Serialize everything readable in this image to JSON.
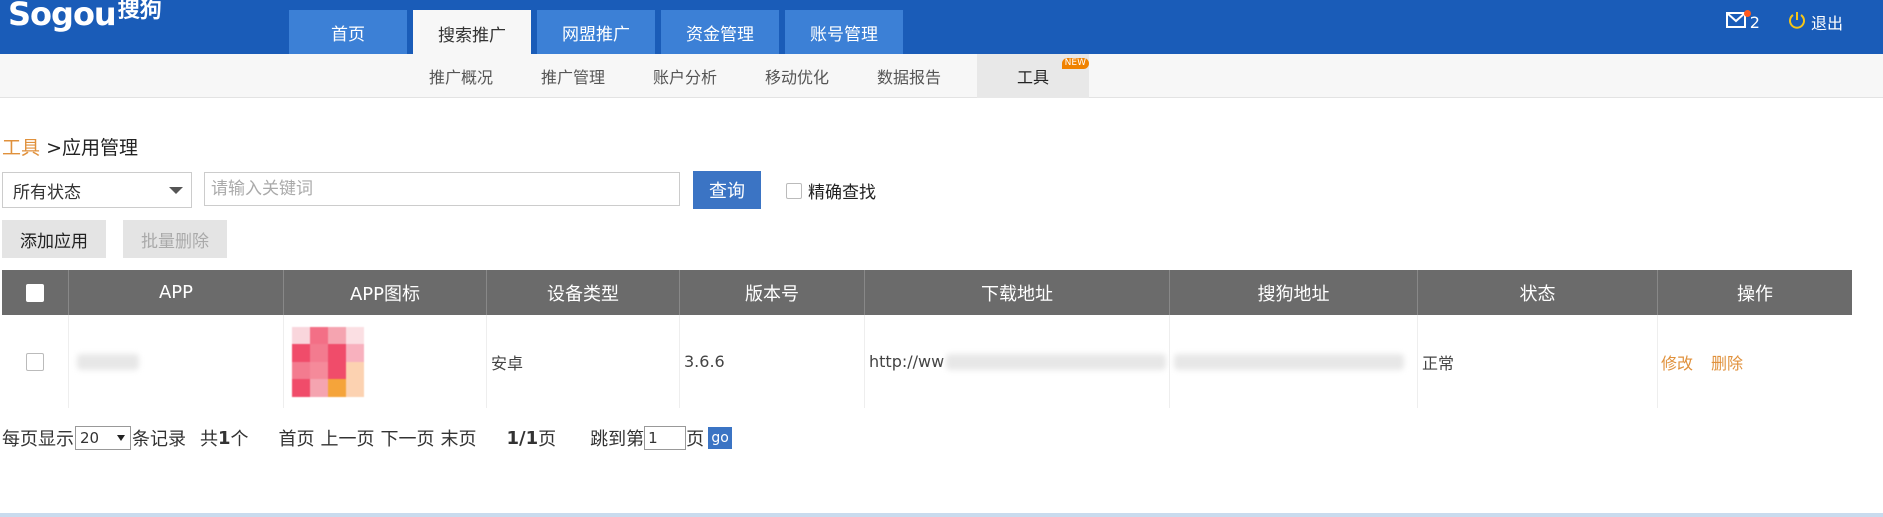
{
  "header": {
    "logo_text": "Sogou",
    "logo_cn": "搜狗",
    "tabs": [
      {
        "label": "首页"
      },
      {
        "label": "搜索推广"
      },
      {
        "label": "网盟推广"
      },
      {
        "label": "资金管理"
      },
      {
        "label": "账号管理"
      }
    ],
    "active_tab": "搜索推广",
    "mail_count": "2",
    "logout_label": "退出"
  },
  "subnav": {
    "items": [
      {
        "label": "推广概况"
      },
      {
        "label": "推广管理"
      },
      {
        "label": "账户分析"
      },
      {
        "label": "移动优化"
      },
      {
        "label": "数据报告"
      },
      {
        "label": "工具"
      }
    ],
    "active": "工具",
    "new_badge": "NEW"
  },
  "breadcrumb": {
    "link": "工具",
    "separator": ">",
    "current": "应用管理"
  },
  "filter": {
    "status_selected": "所有状态",
    "keyword_placeholder": "请输入关键词",
    "query_label": "查询",
    "exact_label": "精确查找"
  },
  "actions": {
    "add_label": "添加应用",
    "batch_delete_label": "批量删除"
  },
  "table": {
    "columns": [
      "APP",
      "APP图标",
      "设备类型",
      "版本号",
      "下载地址",
      "搜狗地址",
      "状态",
      "操作"
    ],
    "rows": [
      {
        "device_type": "安卓",
        "version": "3.6.6",
        "download_url_prefix": "http://ww",
        "status": "正常",
        "edit_label": "修改",
        "delete_label": "删除"
      }
    ]
  },
  "pagination": {
    "per_page_prefix": "每页显示",
    "per_page_value": "20",
    "per_page_suffix": "条记录",
    "total_prefix": "共",
    "total_count": "1",
    "total_suffix": "个",
    "first": "首页",
    "prev": "上一页",
    "next": "下一页",
    "last": "末页",
    "page_indicator": "1/1",
    "page_suffix": "页",
    "jump_prefix": "跳到第",
    "jump_value": "1",
    "jump_suffix": "页",
    "go_label": "go"
  },
  "colors": {
    "header_bg": "#1a5cb8",
    "tab_bg": "#3c80d6",
    "table_header_bg": "#6b6b6b",
    "link_orange": "#e0913c",
    "button_blue": "#3b74c4"
  }
}
